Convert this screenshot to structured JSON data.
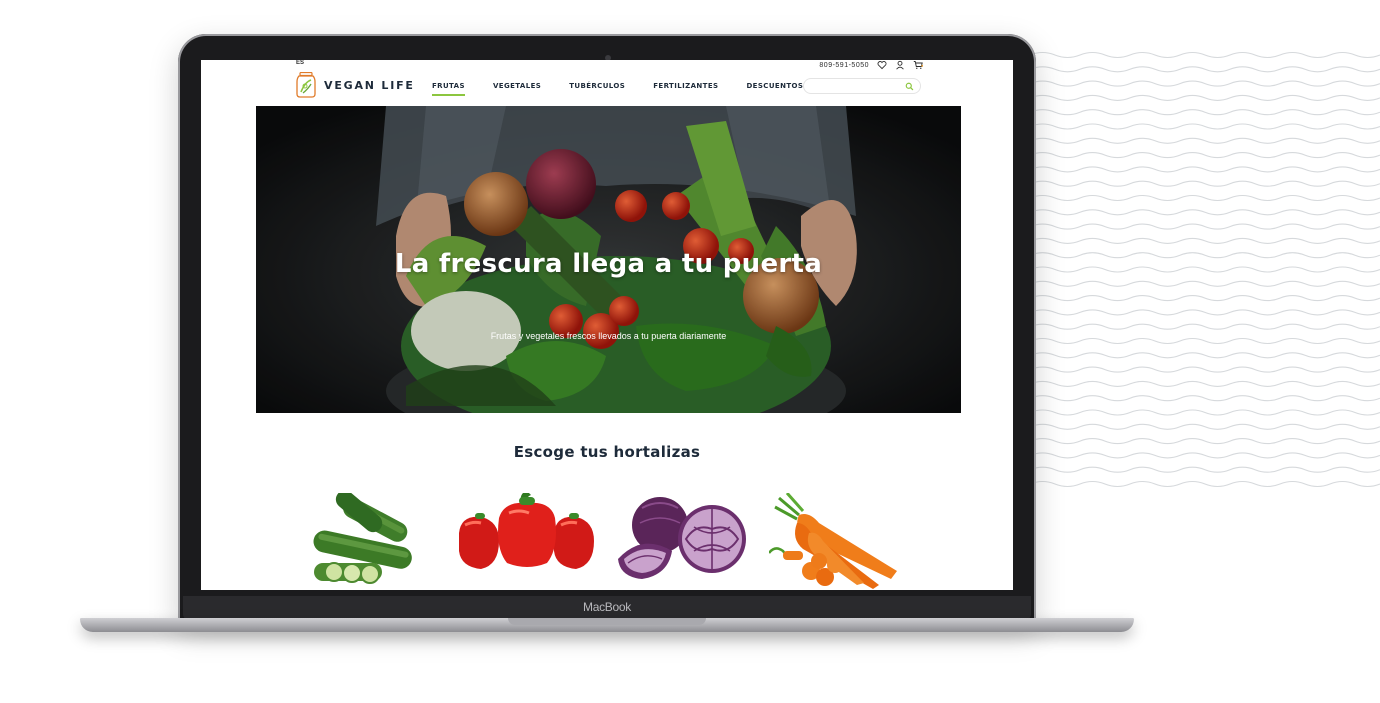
{
  "device": {
    "label": "MacBook"
  },
  "topbar": {
    "left_text": "ES",
    "phone": "809-591-5050"
  },
  "brand": {
    "name": "VEGAN LIFE"
  },
  "nav": {
    "items": [
      {
        "label": "FRUTAS",
        "active": true
      },
      {
        "label": "VEGETALES",
        "active": false
      },
      {
        "label": "TUBÉRCULOS",
        "active": false
      },
      {
        "label": "FERTILIZANTES",
        "active": false
      },
      {
        "label": "DESCUENTOS",
        "active": false
      }
    ]
  },
  "search": {
    "placeholder": ""
  },
  "hero": {
    "title": "La frescura llega a tu puerta",
    "subtitle": "Frutas y vegetales frescos llevados a tu puerta diariamente"
  },
  "section": {
    "title": "Escoge  tus hortalizas"
  },
  "products": [
    {
      "icon": "cucumber-icon"
    },
    {
      "icon": "red-pepper-icon"
    },
    {
      "icon": "red-cabbage-icon"
    },
    {
      "icon": "carrot-icon"
    }
  ],
  "colors": {
    "accent": "#8cc63f",
    "text_dark": "#1e2b3a"
  }
}
